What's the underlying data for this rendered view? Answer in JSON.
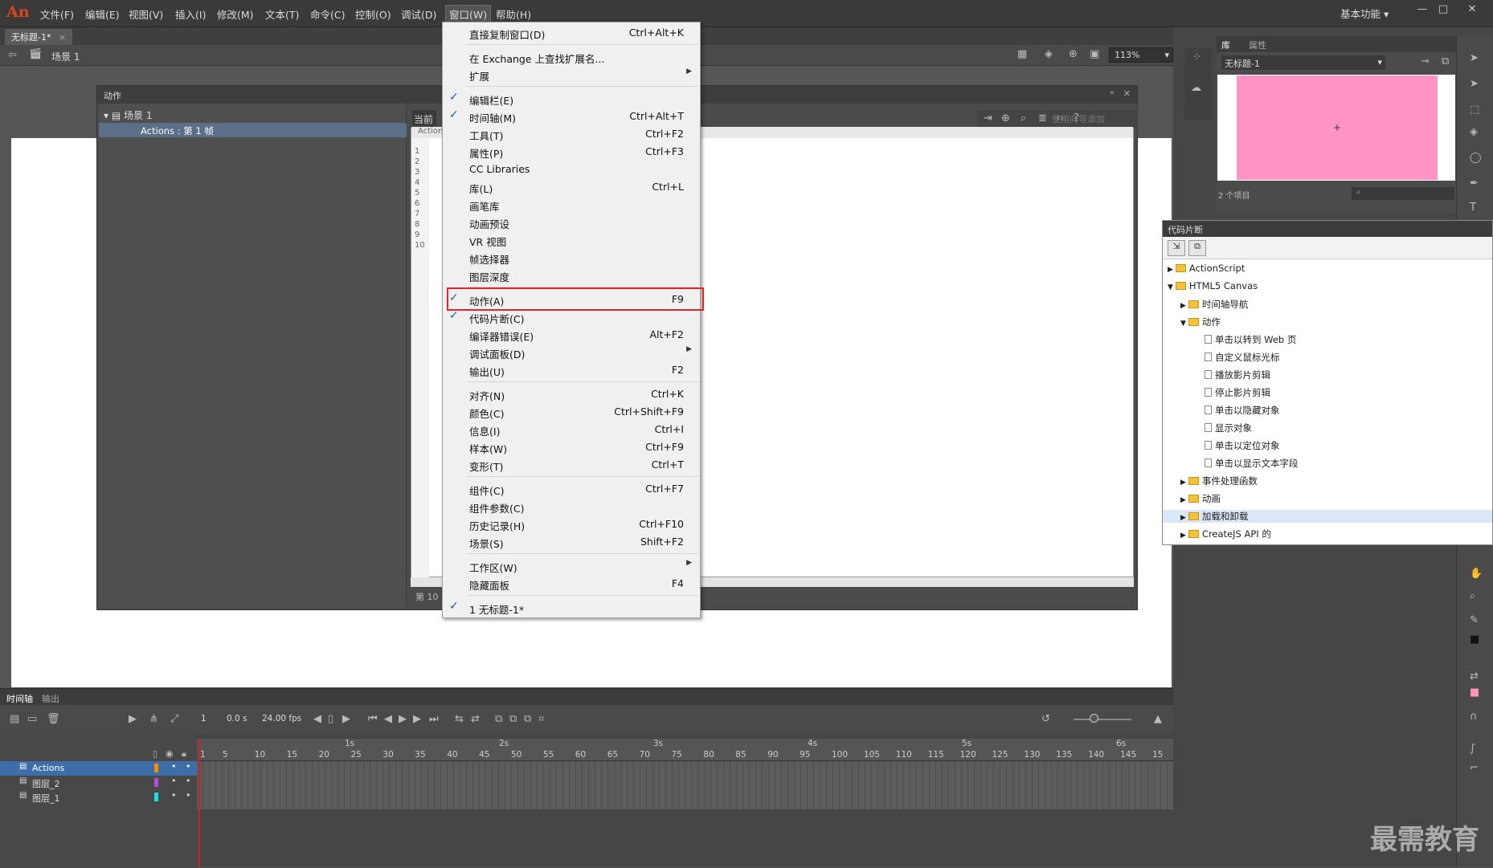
{
  "app": {
    "logo": "An",
    "menu": [
      "文件(F)",
      "编辑(E)",
      "视图(V)",
      "插入(I)",
      "修改(M)",
      "文本(T)",
      "命令(C)",
      "控制(O)",
      "调试(D)",
      "窗口(W)",
      "帮助(H)"
    ],
    "workspace": "基本功能"
  },
  "doc": {
    "tab": "无标题-1*",
    "scene": "场景 1",
    "zoom": "113%"
  },
  "actions_panel": {
    "title": "动作",
    "tree_scene": "场景 1",
    "tree_item": "Actions : 第 1 帧",
    "current_label": "当前",
    "actions_label": "Action",
    "wizard_button": "使用向导添加",
    "line_numbers": "1\n2\n3\n4\n5\n6\n7\n8\n9\n10",
    "status": "第 10"
  },
  "window_menu": {
    "items": [
      {
        "label": "直接复制窗口(D)",
        "shortcut": "Ctrl+Alt+K",
        "checked": false,
        "sub": false
      },
      {
        "sep": true
      },
      {
        "label": "在 Exchange 上查找扩展名...",
        "shortcut": "",
        "checked": false,
        "sub": false
      },
      {
        "label": "扩展",
        "shortcut": "",
        "checked": false,
        "sub": true
      },
      {
        "sep": true
      },
      {
        "label": "编辑栏(E)",
        "shortcut": "",
        "checked": true,
        "sub": false
      },
      {
        "label": "时间轴(M)",
        "shortcut": "Ctrl+Alt+T",
        "checked": true,
        "sub": false
      },
      {
        "label": "工具(T)",
        "shortcut": "Ctrl+F2",
        "checked": false,
        "sub": false
      },
      {
        "label": "属性(P)",
        "shortcut": "Ctrl+F3",
        "checked": false,
        "sub": false
      },
      {
        "label": "CC Libraries",
        "shortcut": "",
        "checked": false,
        "sub": false
      },
      {
        "label": "库(L)",
        "shortcut": "Ctrl+L",
        "checked": false,
        "sub": false
      },
      {
        "label": "画笔库",
        "shortcut": "",
        "checked": false,
        "sub": false
      },
      {
        "label": "动画预设",
        "shortcut": "",
        "checked": false,
        "sub": false
      },
      {
        "label": "VR 视图",
        "shortcut": "",
        "checked": false,
        "sub": false
      },
      {
        "label": "帧选择器",
        "shortcut": "",
        "checked": false,
        "sub": false
      },
      {
        "label": "图层深度",
        "shortcut": "",
        "checked": false,
        "sub": false
      },
      {
        "sep": true
      },
      {
        "label": "动作(A)",
        "shortcut": "F9",
        "checked": true,
        "sub": false
      },
      {
        "label": "代码片断(C)",
        "shortcut": "",
        "checked": true,
        "sub": false
      },
      {
        "label": "编译器错误(E)",
        "shortcut": "Alt+F2",
        "checked": false,
        "sub": false
      },
      {
        "label": "调试面板(D)",
        "shortcut": "",
        "checked": false,
        "sub": true
      },
      {
        "label": "输出(U)",
        "shortcut": "F2",
        "checked": false,
        "sub": false
      },
      {
        "sep": true
      },
      {
        "label": "对齐(N)",
        "shortcut": "Ctrl+K",
        "checked": false,
        "sub": false
      },
      {
        "label": "颜色(C)",
        "shortcut": "Ctrl+Shift+F9",
        "checked": false,
        "sub": false
      },
      {
        "label": "信息(I)",
        "shortcut": "Ctrl+I",
        "checked": false,
        "sub": false
      },
      {
        "label": "样本(W)",
        "shortcut": "Ctrl+F9",
        "checked": false,
        "sub": false
      },
      {
        "label": "变形(T)",
        "shortcut": "Ctrl+T",
        "checked": false,
        "sub": false
      },
      {
        "sep": true
      },
      {
        "label": "组件(C)",
        "shortcut": "Ctrl+F7",
        "checked": false,
        "sub": false
      },
      {
        "label": "组件参数(C)",
        "shortcut": "",
        "checked": false,
        "sub": false
      },
      {
        "label": "历史记录(H)",
        "shortcut": "Ctrl+F10",
        "checked": false,
        "sub": false
      },
      {
        "label": "场景(S)",
        "shortcut": "Shift+F2",
        "checked": false,
        "sub": false
      },
      {
        "sep": true
      },
      {
        "label": "工作区(W)",
        "shortcut": "",
        "checked": false,
        "sub": true
      },
      {
        "label": "隐藏面板",
        "shortcut": "F4",
        "checked": false,
        "sub": false
      },
      {
        "sep": true
      },
      {
        "label": "1 无标题-1*",
        "shortcut": "",
        "checked": true,
        "sub": false
      }
    ]
  },
  "library": {
    "tab_library": "库",
    "tab_properties": "属性",
    "doc_select": "无标题-1",
    "count": "2 个项目"
  },
  "code_snippets": {
    "title": "代码片断",
    "nodes": [
      {
        "label": "ActionScript",
        "type": "folder",
        "level": 0,
        "open": false
      },
      {
        "label": "HTML5 Canvas",
        "type": "folder",
        "level": 0,
        "open": true
      },
      {
        "label": "时间轴导航",
        "type": "folder",
        "level": 1,
        "open": false
      },
      {
        "label": "动作",
        "type": "folder",
        "level": 1,
        "open": true
      },
      {
        "label": "单击以转到 Web 页",
        "type": "doc",
        "level": 2
      },
      {
        "label": "自定义鼠标光标",
        "type": "doc",
        "level": 2
      },
      {
        "label": "播放影片剪辑",
        "type": "doc",
        "level": 2
      },
      {
        "label": "停止影片剪辑",
        "type": "doc",
        "level": 2
      },
      {
        "label": "单击以隐藏对象",
        "type": "doc",
        "level": 2
      },
      {
        "label": "显示对象",
        "type": "doc",
        "level": 2
      },
      {
        "label": "单击以定位对象",
        "type": "doc",
        "level": 2
      },
      {
        "label": "单击以显示文本字段",
        "type": "doc",
        "level": 2
      },
      {
        "label": "事件处理函数",
        "type": "folder",
        "level": 1,
        "open": false
      },
      {
        "label": "动画",
        "type": "folder",
        "level": 1,
        "open": false
      },
      {
        "label": "加载和卸载",
        "type": "folder",
        "level": 1,
        "open": false,
        "hover": true
      },
      {
        "label": "CreateJS API 的",
        "type": "folder",
        "level": 1,
        "open": false
      }
    ]
  },
  "timeline": {
    "tab_timeline": "时间轴",
    "tab_output": "输出",
    "frame": "1",
    "time": "0.0 s",
    "fps": "24.00 fps",
    "seconds": [
      "1s",
      "2s",
      "3s",
      "4s",
      "5s",
      "6s"
    ],
    "ticks": [
      "1",
      "5",
      "10",
      "15",
      "20",
      "25",
      "30",
      "35",
      "40",
      "45",
      "50",
      "55",
      "60",
      "65",
      "70",
      "75",
      "80",
      "85",
      "90",
      "95",
      "100",
      "105",
      "110",
      "115",
      "120",
      "125",
      "130",
      "135",
      "140",
      "145",
      "15"
    ],
    "layers": [
      {
        "name": "Actions",
        "color": "#ff8a00",
        "selected": true
      },
      {
        "name": "图层_2",
        "color": "#b04fd6",
        "selected": false
      },
      {
        "name": "图层_1",
        "color": "#18e0e0",
        "selected": false
      }
    ]
  },
  "watermark": "最需教育"
}
